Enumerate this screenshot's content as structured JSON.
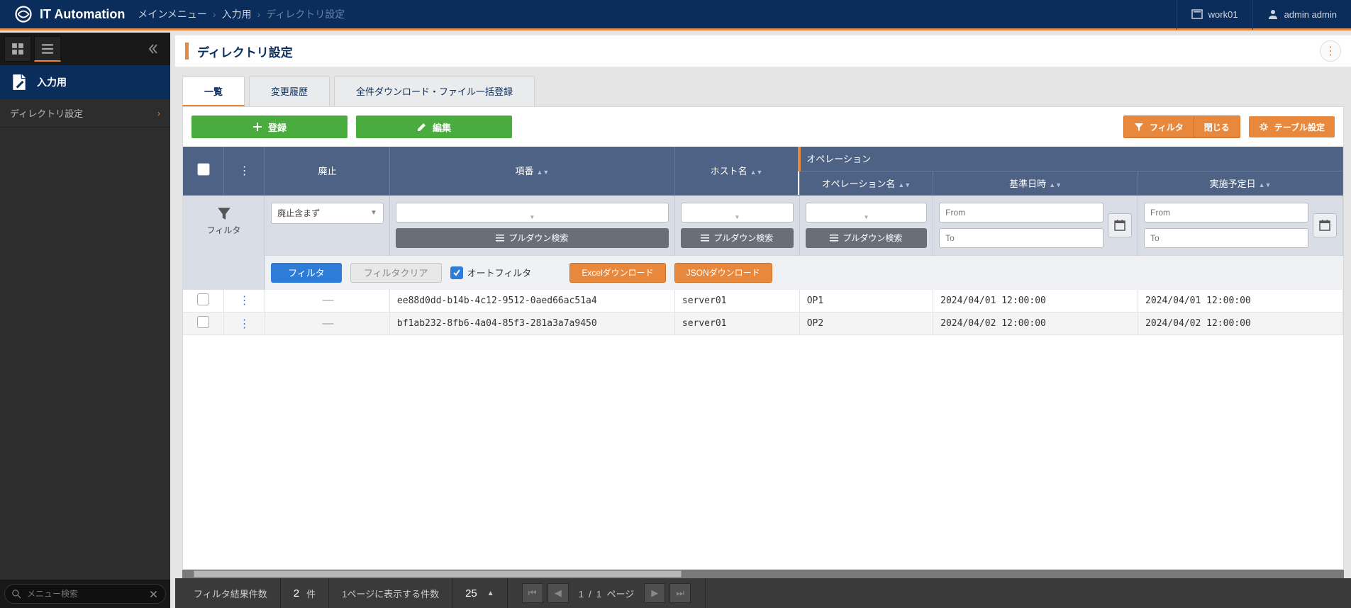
{
  "header": {
    "product_name": "IT Automation",
    "breadcrumb": [
      "メインメニュー",
      "入力用",
      "ディレクトリ設定"
    ],
    "workspace": "work01",
    "user": "admin admin"
  },
  "sidebar": {
    "group_label": "入力用",
    "nav_item": "ディレクトリ設定",
    "search_placeholder": "メニュー検索"
  },
  "page": {
    "title": "ディレクトリ設定",
    "tabs": {
      "list": "一覧",
      "history": "変更履歴",
      "bulk": "全件ダウンロード・ファイル一括登録"
    }
  },
  "toolbar": {
    "register": "登録",
    "edit": "編集",
    "filter": "フィルタ",
    "close": "閉じる",
    "table_settings": "テーブル設定"
  },
  "table": {
    "columns": {
      "haishi": "廃止",
      "kouban": "項番",
      "hostname": "ホスト名",
      "operation_group": "オペレーション",
      "operation_name": "オペレーション名",
      "ref_date": "基準日時",
      "exec_date": "実施予定日"
    },
    "filter_label": "フィルタ",
    "haishi_select": "廃止含まず",
    "pulldown_search": "プルダウン検索",
    "date_from": "From",
    "date_to": "To",
    "filter_btn": "フィルタ",
    "filter_clear": "フィルタクリア",
    "auto_filter": "オートフィルタ",
    "excel_dl": "Excelダウンロード",
    "json_dl": "JSONダウンロード",
    "rows": [
      {
        "id": "ee88d0dd-b14b-4c12-9512-0aed66ac51a4",
        "host": "server01",
        "op": "OP1",
        "ref": "2024/04/01 12:00:00",
        "exec": "2024/04/01 12:00:00"
      },
      {
        "id": "bf1ab232-8fb6-4a04-85f3-281a3a7a9450",
        "host": "server01",
        "op": "OP2",
        "ref": "2024/04/02 12:00:00",
        "exec": "2024/04/02 12:00:00"
      }
    ]
  },
  "footer": {
    "filter_result_label": "フィルタ結果件数",
    "count": "2",
    "count_unit": "件",
    "per_page_label": "1ページに表示する件数",
    "per_page": "25",
    "page_current": "1",
    "page_total": "1",
    "page_unit": "ページ"
  }
}
